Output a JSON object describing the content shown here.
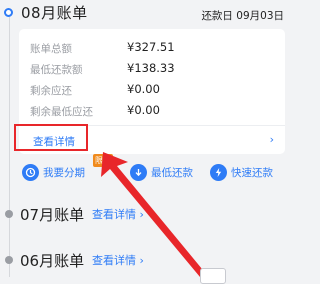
{
  "current_bill": {
    "month_title": "08月账单",
    "due_label": "还款日 09月03日",
    "rows": [
      {
        "label": "账单总额",
        "value": "¥327.51"
      },
      {
        "label": "最低还款额",
        "value": "¥138.33"
      },
      {
        "label": "剩余应还",
        "value": "¥0.00"
      },
      {
        "label": "剩余最低应还",
        "value": "¥0.00"
      }
    ],
    "details_link": "查看详情",
    "chevron": "›"
  },
  "actions": [
    {
      "label": "我要分期",
      "icon": "clock-icon"
    },
    {
      "label": "最低还款",
      "icon": "download-icon"
    },
    {
      "label": "快速还款",
      "icon": "lightning-icon"
    }
  ],
  "badge": "限时",
  "past_bills": [
    {
      "month_title": "07月账单",
      "link": "查看详情 ›"
    },
    {
      "month_title": "06月账单",
      "link": "查看详情 ›"
    }
  ],
  "colors": {
    "accent": "#2f7cf6",
    "highlight": "#e8262a",
    "badge": "#f08a1c"
  }
}
